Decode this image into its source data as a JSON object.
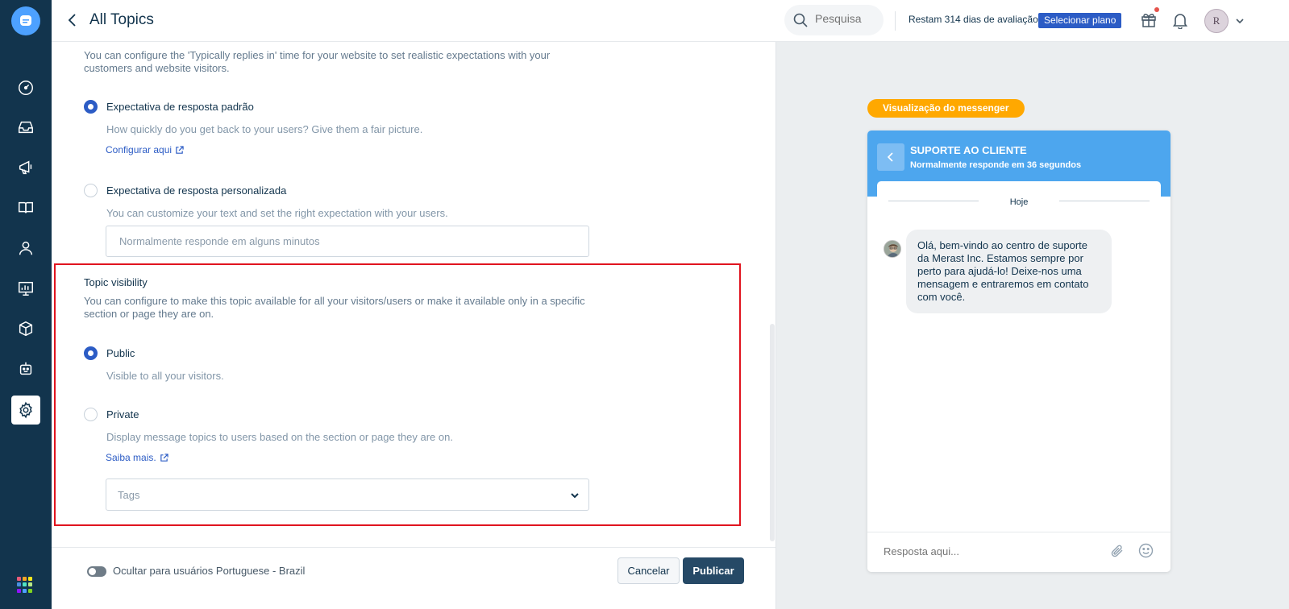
{
  "header": {
    "title": "All Topics",
    "search_placeholder": "Pesquisa",
    "trial_text": "Restam 314 dias de avaliação",
    "plan_button": "Selecionar plano",
    "avatar_initial": "R"
  },
  "sidebar": {
    "items": [
      "dashboard-icon",
      "inbox-icon",
      "campaigns-icon",
      "knowledge-base-icon",
      "contacts-icon",
      "reports-icon",
      "apps-icon",
      "bot-icon",
      "settings-icon"
    ],
    "active": "settings-icon"
  },
  "response": {
    "description": "You can configure the 'Typically replies in' time for your website to set realistic expectations with your customers and website visitors.",
    "options": [
      {
        "label": "Expectativa de resposta padrão",
        "help": "How quickly do you get back to your users? Give them a fair picture.",
        "link": "Configurar aqui",
        "checked": true
      },
      {
        "label": "Expectativa de resposta personalizada",
        "help": "You can customize your text and set the right expectation with your users.",
        "input_placeholder": "Normalmente responde em alguns minutos",
        "checked": false
      }
    ]
  },
  "visibility": {
    "title": "Topic visibility",
    "description": "You can configure to make this topic available for all your visitors/users or make it available only in a specific section or page they are on.",
    "options": [
      {
        "label": "Public",
        "help": "Visible to all your visitors.",
        "checked": true
      },
      {
        "label": "Private",
        "help": "Display message topics to users based on the section or page they are on.",
        "link": "Saiba mais.",
        "checked": false
      }
    ],
    "tags_placeholder": "Tags"
  },
  "footer": {
    "toggle_label": "Ocultar para usuários Portuguese - Brazil",
    "toggle_on": false,
    "cancel": "Cancelar",
    "publish": "Publicar"
  },
  "preview": {
    "badge": "Visualização do messenger",
    "team_name": "SUPORTE AO CLIENTE",
    "reply_time": "Normalmente responde em 36 segundos",
    "day": "Hoje",
    "message": "Olá, bem-vindo ao centro de suporte da Merast Inc. Estamos sempre por perto para ajudá-lo! Deixe-nos uma mensagem e entraremos em contato com você.",
    "reply_placeholder": "Resposta aqui..."
  },
  "colors": {
    "sidebar_bg": "#12344d",
    "primary": "#2c5cc5",
    "highlight": "#e0141f",
    "preview_header": "#4da6ee",
    "badge": "#ffa800",
    "publish_btn": "#264966"
  }
}
